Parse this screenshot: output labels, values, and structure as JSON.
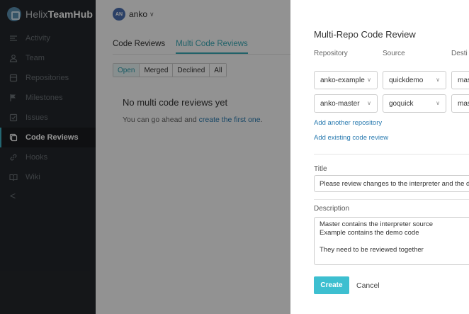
{
  "sidebar": {
    "brand": {
      "light": "Helix",
      "bold": "TeamHub"
    },
    "items": [
      {
        "label": "Activity",
        "icon": "activity-icon"
      },
      {
        "label": "Team",
        "icon": "team-icon"
      },
      {
        "label": "Repositories",
        "icon": "repositories-icon"
      },
      {
        "label": "Milestones",
        "icon": "flag-icon"
      },
      {
        "label": "Issues",
        "icon": "issues-icon"
      },
      {
        "label": "Code Reviews",
        "icon": "code-reviews-icon",
        "active": true
      },
      {
        "label": "Hooks",
        "icon": "link-icon"
      },
      {
        "label": "Wiki",
        "icon": "book-icon"
      }
    ],
    "collapse_glyph": "<"
  },
  "topbar": {
    "avatar_initials": "AN",
    "user": "anko",
    "caret": "∨"
  },
  "main": {
    "tabs": [
      "Code Reviews",
      "Multi Code Reviews"
    ],
    "active_tab": "Multi Code Reviews",
    "filters": [
      "Open",
      "Merged",
      "Declined",
      "All"
    ],
    "active_filter": "Open",
    "empty_title": "No multi code reviews yet",
    "empty_text_prefix": "You can go ahead and ",
    "empty_link": "create the first one",
    "empty_text_suffix": "."
  },
  "modal": {
    "title": "Multi-Repo Code Review",
    "columns": [
      "Repository",
      "Source",
      "Desti"
    ],
    "rows": [
      {
        "repository": "anko-example",
        "source": "quickdemo",
        "destination": "mas"
      },
      {
        "repository": "anko-master",
        "source": "goquick",
        "destination": "mas"
      }
    ],
    "add_repository": "Add another repository",
    "add_existing": "Add existing code review",
    "title_label": "Title",
    "title_value": "Please review changes to the interpreter and the demo",
    "description_label": "Description",
    "description_lines": [
      "Master contains the interpreter source",
      "Example contains the demo code",
      "",
      "They need to be reviewed together"
    ],
    "create_label": "Create",
    "cancel_label": "Cancel"
  },
  "colors": {
    "sidebar_bg": "#24272b",
    "accent": "#3dbfd0",
    "link": "#2a7bb0",
    "active_tab": "#3aa9b6"
  }
}
